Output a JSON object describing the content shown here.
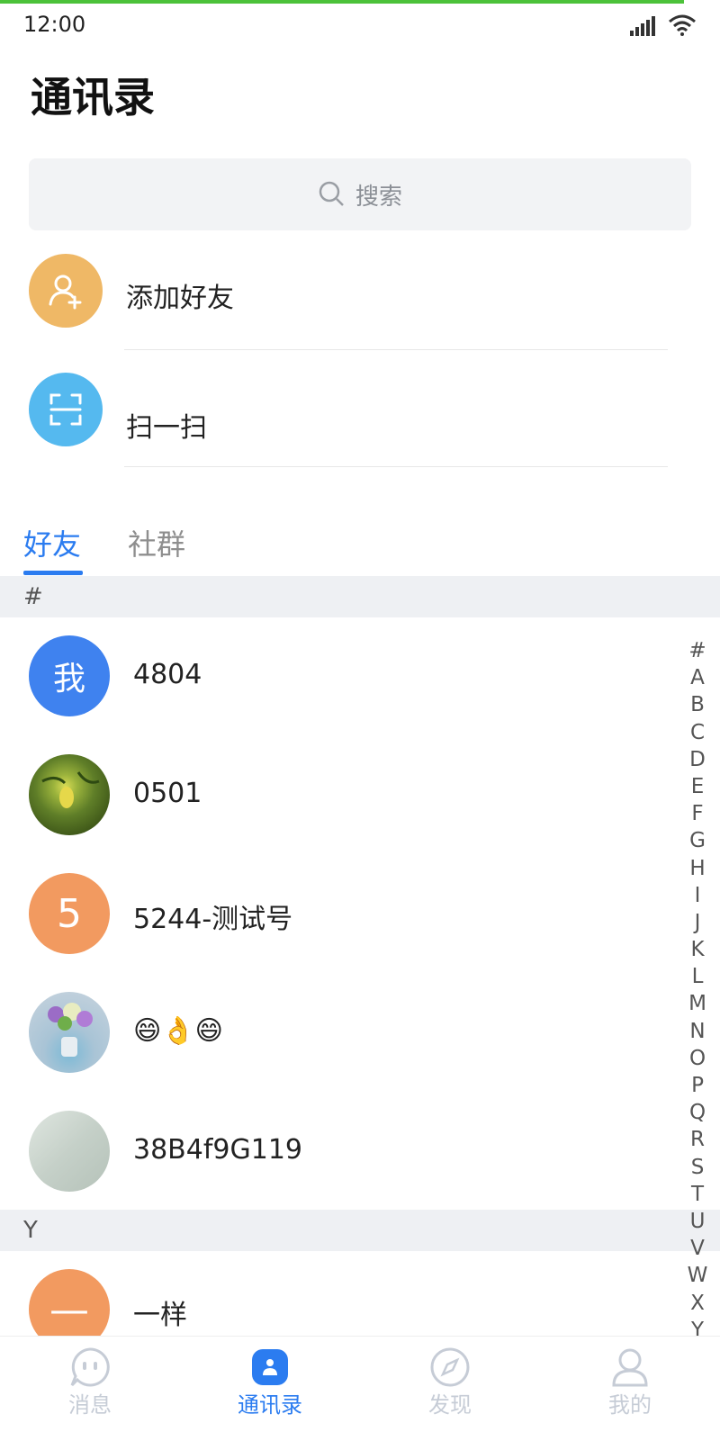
{
  "status_bar": {
    "time": "12:00"
  },
  "page": {
    "title": "通讯录"
  },
  "search": {
    "placeholder": "搜索"
  },
  "actions": [
    {
      "label": "添加好友",
      "icon": "add-friend-icon",
      "color": "#efb866"
    },
    {
      "label": "扫一扫",
      "icon": "scan-icon",
      "color": "#55b9ef"
    }
  ],
  "tabs": [
    {
      "label": "好友",
      "active": true
    },
    {
      "label": "社群",
      "active": false
    }
  ],
  "sections": [
    {
      "letter": "#",
      "contacts": [
        {
          "name": "4804",
          "avatar_text": "我",
          "avatar_color": "#3f82ef"
        },
        {
          "name": "0501",
          "avatar_text": "",
          "avatar_color": "#6a8a2c"
        },
        {
          "name": "5244-测试号",
          "avatar_text": "5",
          "avatar_color": "#f29a60"
        },
        {
          "name": "😄👌😄",
          "avatar_text": "",
          "avatar_color": "#b7c6d6"
        },
        {
          "name": "38B4f9G119",
          "avatar_text": "",
          "avatar_color": "#c9d3cc"
        }
      ]
    },
    {
      "letter": "Y",
      "contacts": [
        {
          "name": "一样",
          "avatar_text": "—",
          "avatar_color": "#f29a60"
        }
      ]
    }
  ],
  "alpha_index": [
    "#",
    "A",
    "B",
    "C",
    "D",
    "E",
    "F",
    "G",
    "H",
    "I",
    "J",
    "K",
    "L",
    "M",
    "N",
    "O",
    "P",
    "Q",
    "R",
    "S",
    "T",
    "U",
    "V",
    "W",
    "X",
    "Y"
  ],
  "bottom_nav": [
    {
      "label": "消息",
      "icon": "message-icon",
      "active": false
    },
    {
      "label": "通讯录",
      "icon": "contacts-icon",
      "active": true
    },
    {
      "label": "发现",
      "icon": "compass-icon",
      "active": false
    },
    {
      "label": "我的",
      "icon": "profile-icon",
      "active": false
    }
  ],
  "colors": {
    "accent": "#2b7cf0",
    "progress": "#4cc23a",
    "section_bg": "#eef0f3",
    "search_bg": "#f2f3f5"
  }
}
